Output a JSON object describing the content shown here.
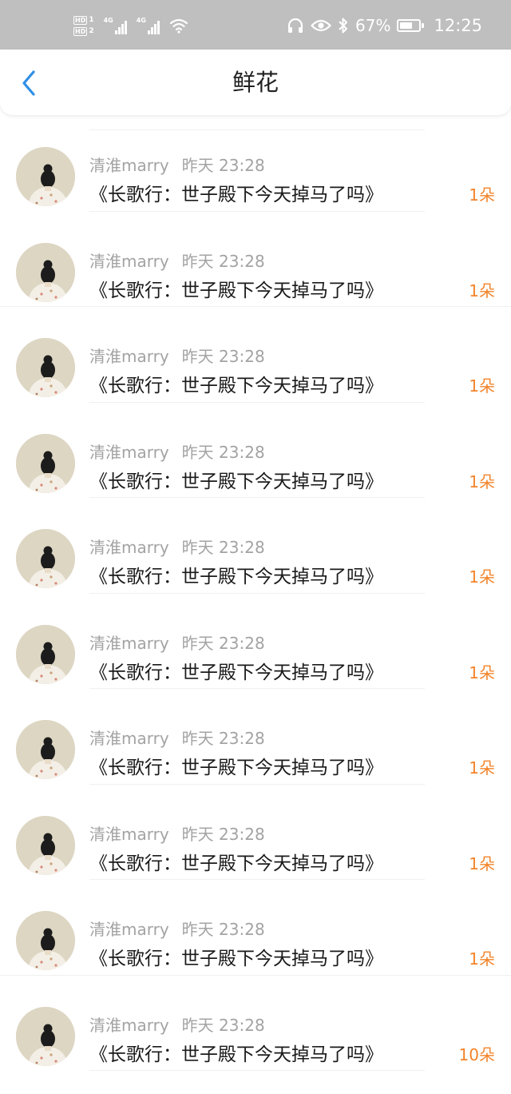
{
  "status_bar": {
    "hd1": "HD",
    "hd1_num": "1",
    "hd2": "HD",
    "hd2_num": "2",
    "network1": "4G",
    "network2": "4G",
    "battery_percent": "67%",
    "battery_level": 0.67,
    "time": "12:25",
    "icons": [
      "headphones-icon",
      "eye-icon",
      "bluetooth-icon",
      "wifi-icon",
      "signal-icon",
      "battery-icon"
    ]
  },
  "nav": {
    "title": "鲜花",
    "back_icon": "chevron-left-icon",
    "accent_color": "#2f8fe6"
  },
  "colors": {
    "count": "#f3842b",
    "meta": "#a3a3a3"
  },
  "items": [
    {
      "user": "清淮marry",
      "time": "昨天 23:28",
      "book": "《长歌行：世子殿下今天掉马了吗》",
      "count": "1朵"
    },
    {
      "user": "清淮marry",
      "time": "昨天 23:28",
      "book": "《长歌行：世子殿下今天掉马了吗》",
      "count": "1朵"
    },
    {
      "user": "清淮marry",
      "time": "昨天 23:28",
      "book": "《长歌行：世子殿下今天掉马了吗》",
      "count": "1朵"
    },
    {
      "user": "清淮marry",
      "time": "昨天 23:28",
      "book": "《长歌行：世子殿下今天掉马了吗》",
      "count": "1朵"
    },
    {
      "user": "清淮marry",
      "time": "昨天 23:28",
      "book": "《长歌行：世子殿下今天掉马了吗》",
      "count": "1朵"
    },
    {
      "user": "清淮marry",
      "time": "昨天 23:28",
      "book": "《长歌行：世子殿下今天掉马了吗》",
      "count": "1朵"
    },
    {
      "user": "清淮marry",
      "time": "昨天 23:28",
      "book": "《长歌行：世子殿下今天掉马了吗》",
      "count": "1朵"
    },
    {
      "user": "清淮marry",
      "time": "昨天 23:28",
      "book": "《长歌行：世子殿下今天掉马了吗》",
      "count": "1朵"
    },
    {
      "user": "清淮marry",
      "time": "昨天 23:28",
      "book": "《长歌行：世子殿下今天掉马了吗》",
      "count": "1朵"
    },
    {
      "user": "清淮marry",
      "time": "昨天 23:28",
      "book": "《长歌行：世子殿下今天掉马了吗》",
      "count": "10朵"
    }
  ]
}
